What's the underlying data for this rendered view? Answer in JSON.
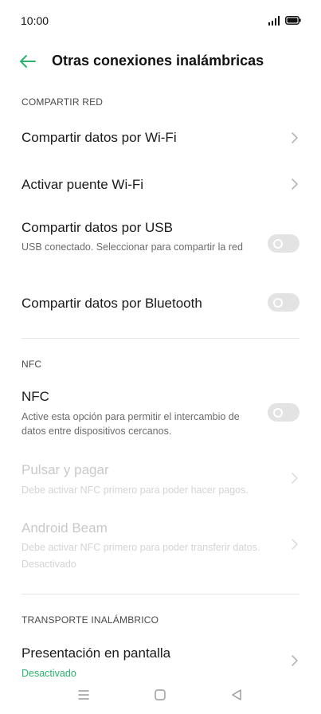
{
  "status_bar": {
    "time": "10:00"
  },
  "header": {
    "title": "Otras conexiones inalámbricas"
  },
  "sections": {
    "tethering": {
      "header": "COMPARTIR RED",
      "wifi_hotspot": "Compartir datos por Wi-Fi",
      "wifi_bridge": "Activar puente Wi-Fi",
      "usb_title": "Compartir datos por USB",
      "usb_subtitle": "USB conectado. Seleccionar para compartir la red",
      "usb_on": false,
      "bluetooth_title": "Compartir datos por Bluetooth",
      "bluetooth_on": false
    },
    "nfc": {
      "header": "NFC",
      "nfc_title": "NFC",
      "nfc_subtitle": "Active esta opción para permitir el intercambio de datos entre dispositivos cercanos.",
      "nfc_on": false,
      "tap_pay_title": "Pulsar y pagar",
      "tap_pay_subtitle": "Debe activar NFC primero para poder hacer pagos.",
      "beam_title": "Android Beam",
      "beam_subtitle": "Debe activar NFC primero para poder transferir datos.",
      "beam_status": "Desactivado"
    },
    "wireless_transport": {
      "header": "TRANSPORTE INALÁMBRICO",
      "screen_title": "Presentación en pantalla",
      "screen_status": "Desactivado"
    }
  },
  "colors": {
    "accent": "#2bb36b",
    "toggle_off": "#e3e3e3",
    "disabled_text": "#c9c9c9"
  }
}
